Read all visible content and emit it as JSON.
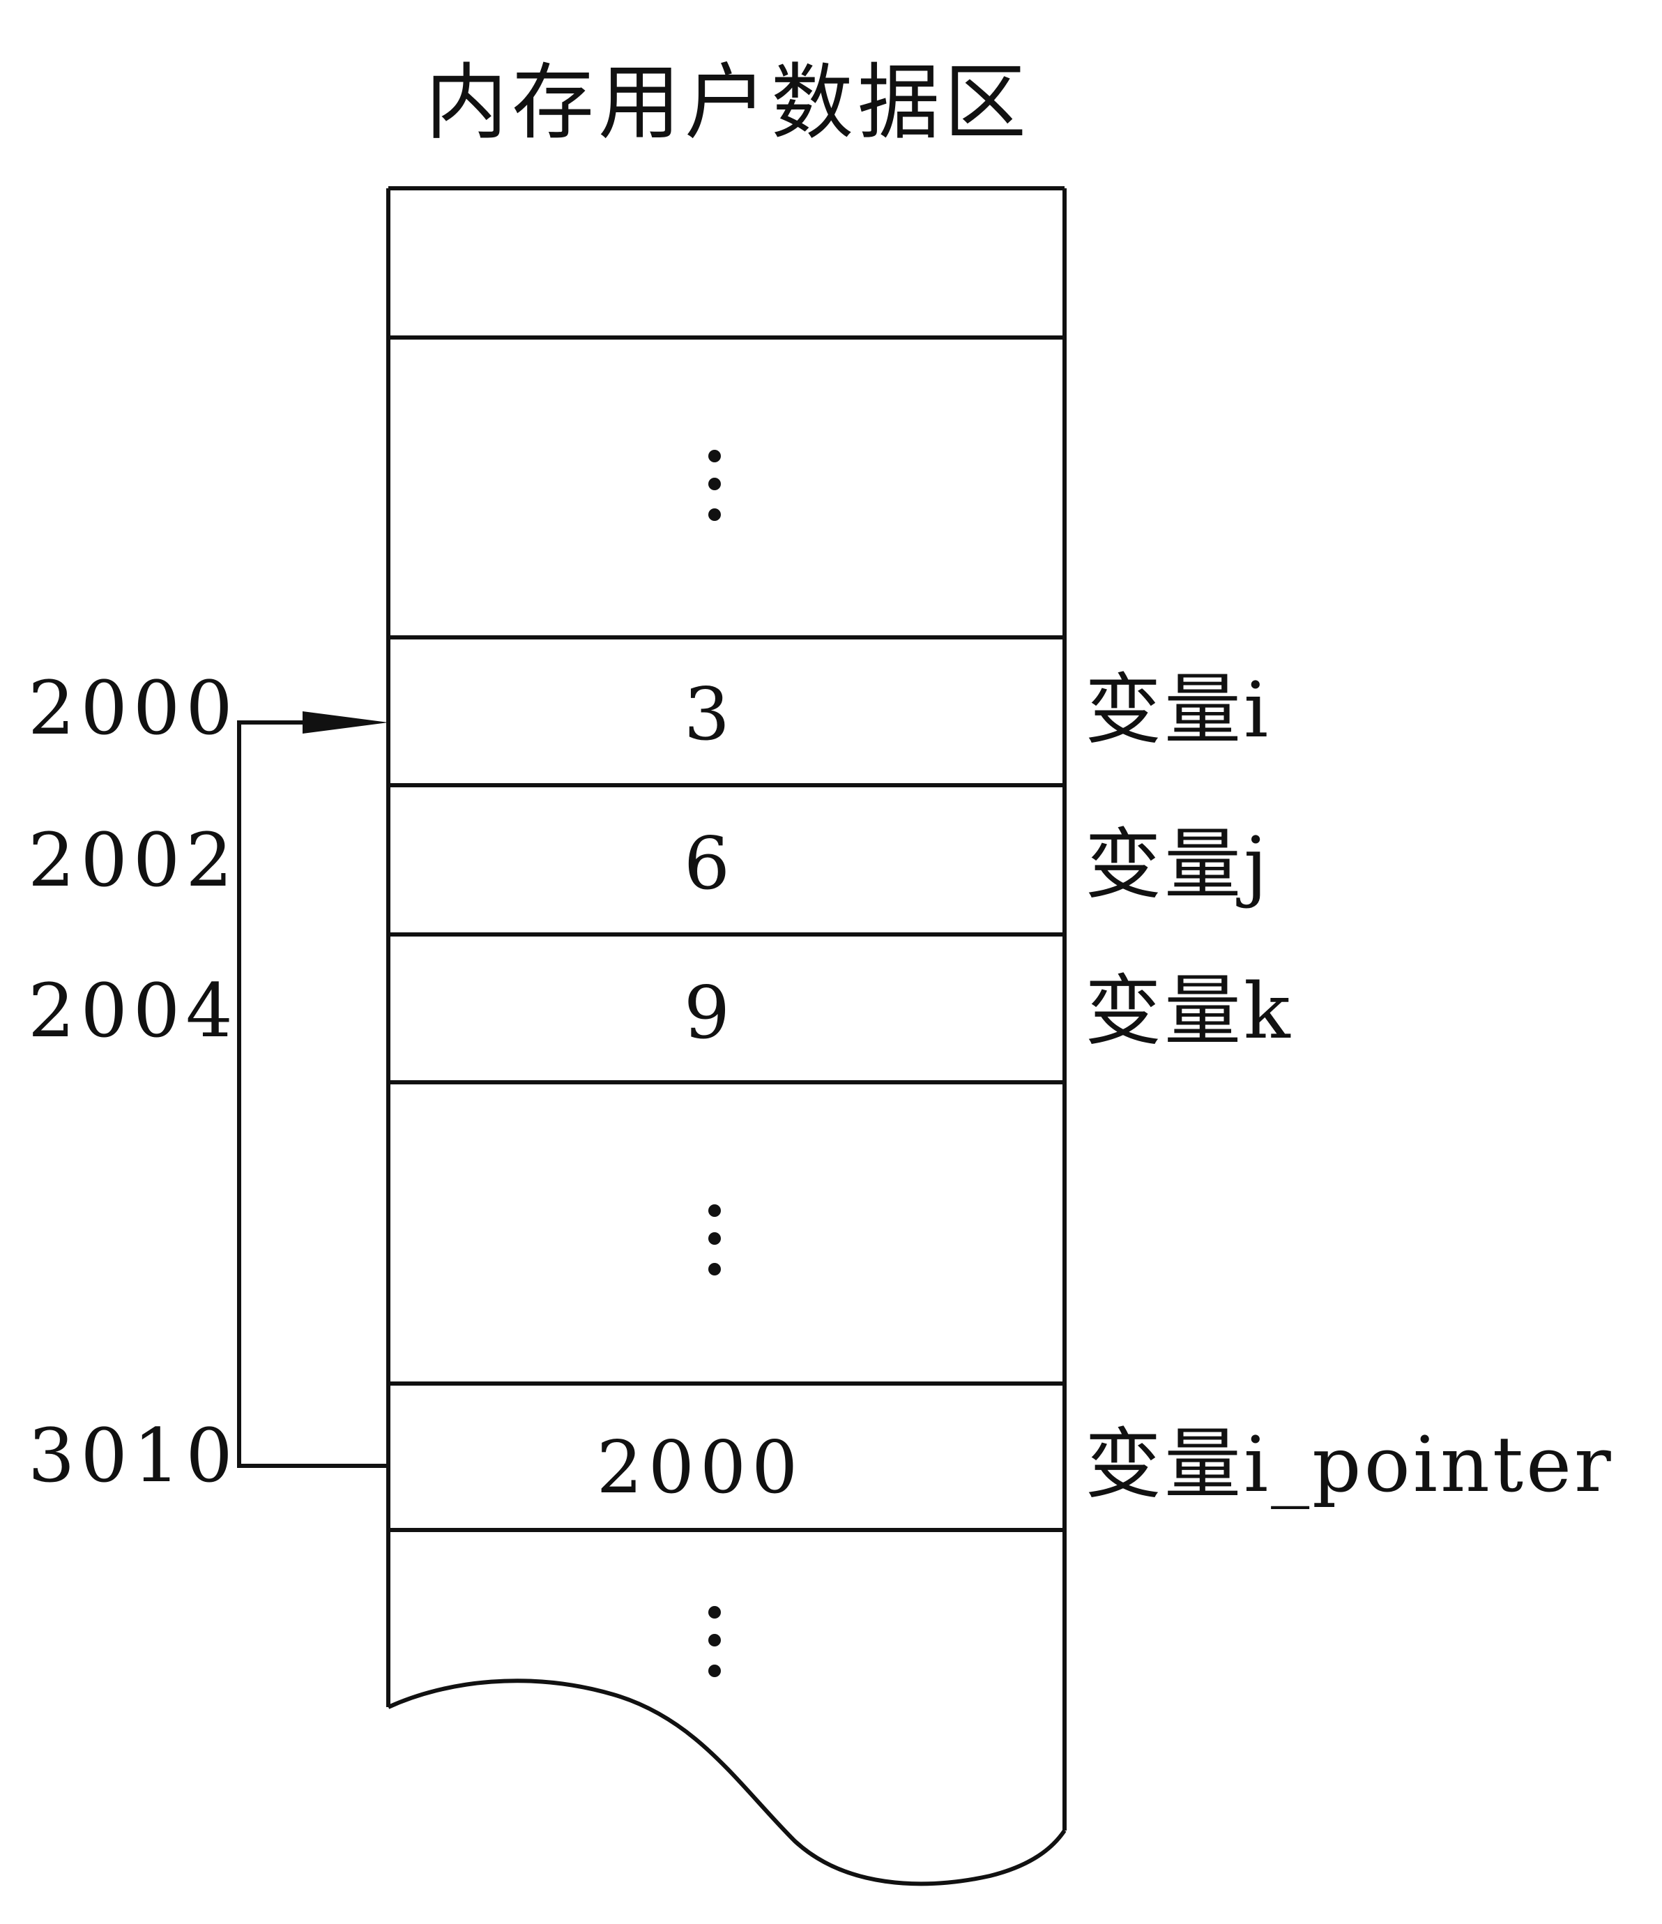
{
  "title": "内存用户数据区",
  "cells": [
    {
      "value": "",
      "address": "",
      "variable": ""
    },
    {
      "value": "⋮",
      "address": "",
      "variable": ""
    },
    {
      "value": "3",
      "address": "2000",
      "variable": "变量i"
    },
    {
      "value": "6",
      "address": "2002",
      "variable": "变量j"
    },
    {
      "value": "9",
      "address": "2004",
      "variable": "变量k"
    },
    {
      "value": "⋮",
      "address": "",
      "variable": ""
    },
    {
      "value": "2000",
      "address": "3010",
      "variable": "变量i_pointer"
    },
    {
      "value": "⋮",
      "address": "",
      "variable": ""
    }
  ],
  "pointer": {
    "from": "3010",
    "to": "2000"
  },
  "colors": {
    "ink": "#111111",
    "background": "#ffffff"
  }
}
